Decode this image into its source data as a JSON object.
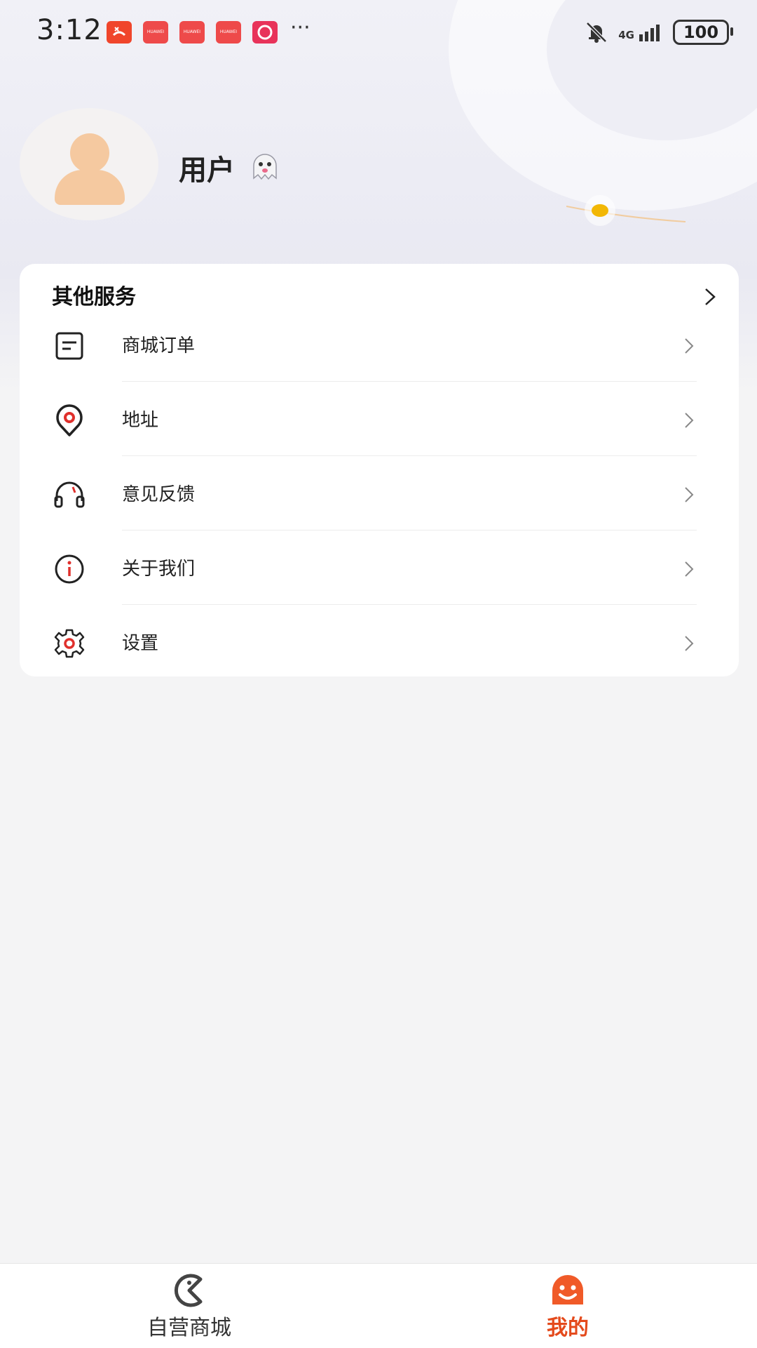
{
  "status_bar": {
    "time": "3:12",
    "notification_icons": [
      "missed-call-icon",
      "huawei-store-icon",
      "huawei-store-icon",
      "huawei-store-icon",
      "taobao-icon"
    ],
    "network": "4G",
    "battery": "100"
  },
  "profile": {
    "username": "用户"
  },
  "services": {
    "title": "其他服务",
    "items": [
      {
        "label": "商城订单",
        "icon": "order-list-icon"
      },
      {
        "label": "地址",
        "icon": "location-pin-icon"
      },
      {
        "label": "意见反馈",
        "icon": "headset-icon"
      },
      {
        "label": "关于我们",
        "icon": "info-icon"
      },
      {
        "label": "设置",
        "icon": "gear-icon"
      }
    ]
  },
  "tabbar": {
    "tabs": [
      {
        "label": "自营商城",
        "icon": "store-icon",
        "active": false
      },
      {
        "label": "我的",
        "icon": "smile-face-icon",
        "active": true
      }
    ]
  },
  "colors": {
    "accent": "#e44a1c",
    "icon_red": "#e0302c",
    "avatar": "#f5c9a0"
  }
}
